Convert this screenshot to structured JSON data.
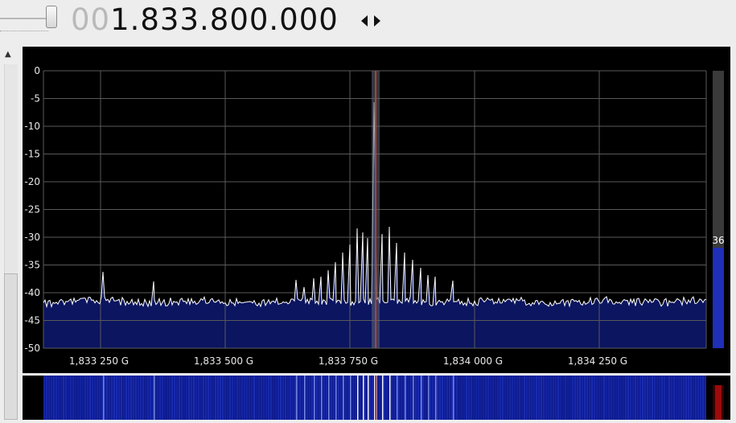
{
  "frequency": {
    "leading_zeros": "00",
    "value": "1.833.800.000"
  },
  "spectrum": {
    "y_labels": [
      "0",
      "-5",
      "-10",
      "-15",
      "-20",
      "-25",
      "-30",
      "-35",
      "-40",
      "-45",
      "-50"
    ],
    "x_labels": [
      "1,833 250 G",
      "1,833 500 G",
      "1,833 750 G",
      "1,834 000 G",
      "1,834 250 G"
    ],
    "level_value": "36",
    "colors": {
      "background": "#000000",
      "grid": "#5a5a5a",
      "trace": "#ffffff",
      "fill": "#0b1560",
      "marker": "#c0392b",
      "level_bar": "#1f2fb8",
      "waterfall": "#0c1a8c"
    }
  }
}
